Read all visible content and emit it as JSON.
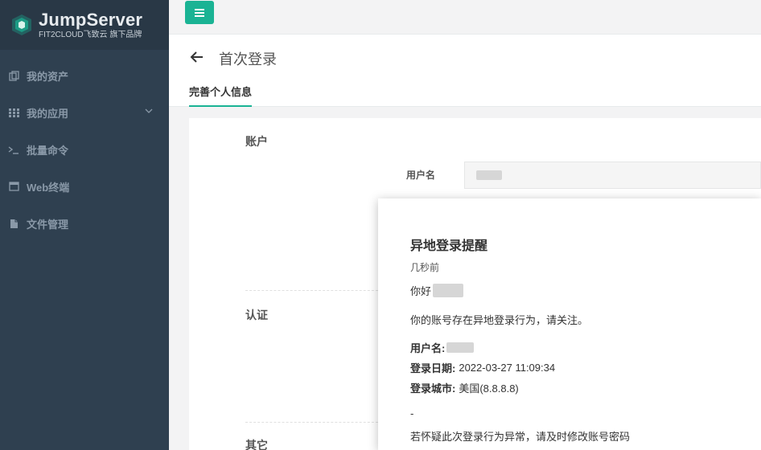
{
  "sidebar": {
    "brand_title": "JumpServer",
    "brand_subtitle": "FIT2CLOUD飞致云 旗下品牌",
    "items": [
      {
        "label": "我的资产",
        "icon": "copy-icon"
      },
      {
        "label": "我的应用",
        "icon": "grid-icon",
        "has_submenu": true
      },
      {
        "label": "批量命令",
        "icon": "terminal-icon"
      },
      {
        "label": "Web终端",
        "icon": "window-icon"
      },
      {
        "label": "文件管理",
        "icon": "file-icon"
      }
    ]
  },
  "header": {
    "page_title": "首次登录",
    "active_tab": "完善个人信息"
  },
  "form": {
    "section_account": "账户",
    "field_username_label": "用户名",
    "section_auth": "认证",
    "section_other": "其它"
  },
  "modal": {
    "title": "异地登录提醒",
    "time": "几秒前",
    "greeting": "你好",
    "message": "你的账号存在异地登录行为，请关注。",
    "username_label": "用户名:",
    "login_date_label": "登录日期:",
    "login_date_value": "2022-03-27 11:09:34",
    "login_city_label": "登录城市:",
    "login_city_value": "美国(8.8.8.8)",
    "dash": "-",
    "advice": "若怀疑此次登录行为异常，请及时修改账号密码"
  },
  "colors": {
    "sidebar_bg": "#2f4050",
    "accent": "#1ab394"
  }
}
